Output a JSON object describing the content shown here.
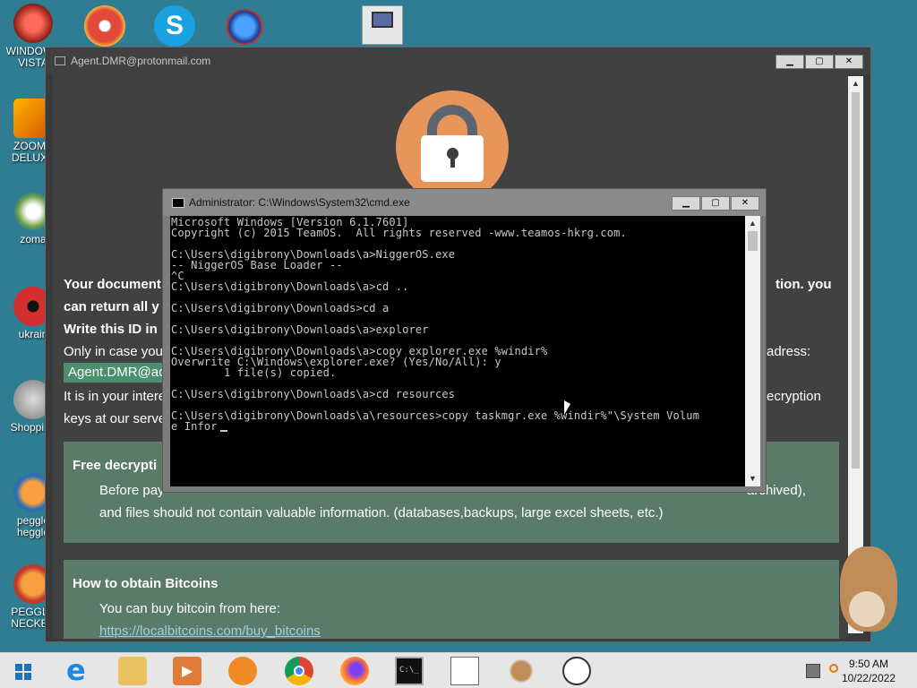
{
  "desktop": {
    "icons": [
      {
        "label": "WINDOWS VISTA",
        "color": "#c0392b"
      },
      {
        "label": "ZOOMA DELUXE",
        "color": "#d35400"
      },
      {
        "label": "zoma",
        "color": "#7f8c8d"
      },
      {
        "label": "ukrain",
        "color": "#c0392b"
      },
      {
        "label": "Shopping",
        "color": "#2980b9"
      },
      {
        "label": "peggle heggle",
        "color": "#d35400"
      },
      {
        "label": "PEGGLE NECKBE",
        "color": "#c0392b"
      }
    ],
    "top_icons": [
      "peggle-icon",
      "skype-icon",
      "internet-explorer-icon",
      "computer-icon"
    ]
  },
  "ransom_window": {
    "title": "Agent.DMR@protonmail.com",
    "lines": {
      "your_documents": "Your document",
      "your_documents_end": "tion. you",
      "can_return": "can return all y",
      "write_id": "Write this ID in",
      "only_in_case": "Only in case you",
      "only_in_case_end": "adress:",
      "email_id": "Agent.DMR@aol",
      "interest": "It is in your intere",
      "interest_end": "ecryption",
      "keys": "keys at our serve"
    },
    "panels": [
      {
        "heading": "Free decrypti",
        "text1_start": "Before pay",
        "text1_end": "archived),",
        "text2": "and files should not contain valuable information. (databases,backups, large excel sheets, etc.)"
      },
      {
        "heading": "How to obtain Bitcoins",
        "text1": "You can buy bitcoin from here:",
        "link": "https://localbitcoins.com/buy_bitcoins"
      }
    ]
  },
  "cmd_window": {
    "title": "Administrator: C:\\Windows\\System32\\cmd.exe",
    "output": "Microsoft Windows [Version 6.1.7601]\nCopyright (c) 2015 TeamOS.  All rights reserved -www.teamos-hkrg.com.\n\nC:\\Users\\digibrony\\Downloads\\a>NiggerOS.exe\n-- NiggerOS Base Loader --\n^C\nC:\\Users\\digibrony\\Downloads\\a>cd ..\n\nC:\\Users\\digibrony\\Downloads>cd a\n\nC:\\Users\\digibrony\\Downloads\\a>explorer\n\nC:\\Users\\digibrony\\Downloads\\a>copy explorer.exe %windir%\nOverwrite C:\\Windows\\explorer.exe? (Yes/No/All): y\n        1 file(s) copied.\n\nC:\\Users\\digibrony\\Downloads\\a>cd resources\n\nC:\\Users\\digibrony\\Downloads\\a\\resources>copy taskmgr.exe %windir%\"\\System Volum\ne Infor"
  },
  "taskbar": {
    "time": "9:50 AM",
    "date": "10/22/2022",
    "apps": [
      "start-icon",
      "internet-explorer-icon",
      "file-explorer-icon",
      "media-player-icon",
      "uc-browser-icon",
      "chrome-icon",
      "firefox-icon",
      "cmd-icon",
      "ransom-app-icon",
      "hamster-icon",
      "clock-app-icon"
    ]
  }
}
